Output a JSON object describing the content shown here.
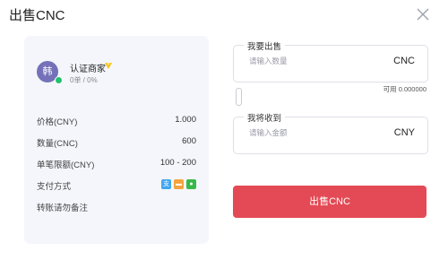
{
  "modal": {
    "title": "出售CNC"
  },
  "merchant": {
    "avatar_text": "韩",
    "label": "认证商家",
    "badge_icon": "verified-diamond-icon",
    "order_stats": "0单 / 0%"
  },
  "details": {
    "rows": [
      {
        "label": "价格(CNY)",
        "value": "1.000"
      },
      {
        "label": "数量(CNC)",
        "value": "600"
      },
      {
        "label": "单笔限额(CNY)",
        "value": "100 - 200"
      },
      {
        "label": "支付方式",
        "value": ""
      },
      {
        "label": "转账请勿备注",
        "value": ""
      }
    ],
    "payment_methods": [
      {
        "icon": "alipay-icon",
        "glyph": "支",
        "color": "#3fa6ef"
      },
      {
        "icon": "bank-card-icon",
        "glyph": "▬",
        "color": "#f3a33c"
      },
      {
        "icon": "wechat-icon",
        "glyph": "●",
        "color": "#39b84a"
      }
    ]
  },
  "sell_form": {
    "sell_field": {
      "legend": "我要出售",
      "placeholder": "请输入数量",
      "unit": "CNC"
    },
    "available": "可用 0.000000",
    "receive_field": {
      "legend": "我将收到",
      "placeholder": "请输入金额",
      "unit": "CNY"
    },
    "submit_label": "出售CNC"
  },
  "colors": {
    "accent": "#e34a55",
    "card_bg": "#f4f6fb",
    "avatar": "#7471b8",
    "online": "#21c06e"
  }
}
